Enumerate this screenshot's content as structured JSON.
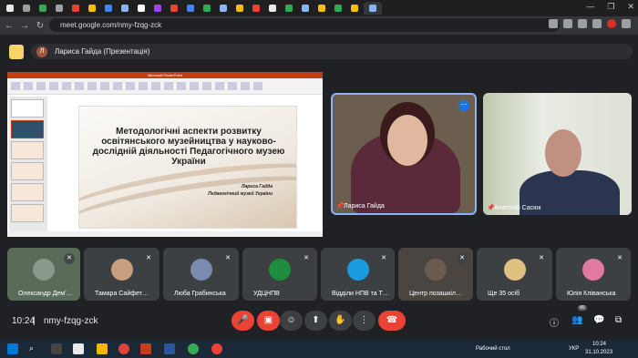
{
  "browser": {
    "url": "meet.google.com/nmy-fzqg-zck",
    "tab_colors": [
      "#e8eaed",
      "#9aa0a6",
      "#34a853",
      "#9aa0a6",
      "#ea4335",
      "#fbbc04",
      "#4285f4",
      "#8ab4f8",
      "#fff",
      "#a142f4",
      "#ea4335",
      "#4285f4",
      "#34a853",
      "#8ab4f8",
      "#fbbc04",
      "#ea4335",
      "#e8eaed",
      "#34a853",
      "#8ab4f8",
      "#fbbc04",
      "#34a853",
      "#fbbc04",
      "#8ab4f8"
    ],
    "window_controls": [
      "—",
      "❐",
      "✕"
    ]
  },
  "presenter": {
    "avatar_letter": "Л",
    "name": "Лариса Гайда (Презентація)"
  },
  "slide": {
    "app_title": "Microsoft PowerPoint",
    "title": "Методологічні аспекти розвитку освітянського музейництва у науково-дослідній діяльності Педагогічного музею України",
    "author": "Лариса Гайда",
    "org": "Педагогічний музей України"
  },
  "participants_main": [
    {
      "name": "Лариса Гайда"
    },
    {
      "name": "Анатолій Сасюк"
    }
  ],
  "participants_strip": [
    {
      "name": "Олександр Дем'…",
      "color": "#5a6b5a"
    },
    {
      "name": "Тамара Сайфет…",
      "color": "#3c4043"
    },
    {
      "name": "Люба Грабинська",
      "color": "#3c4043"
    },
    {
      "name": "УДЦНПВ",
      "color": "#3c4043"
    },
    {
      "name": "Відділи НПВ та Т…",
      "color": "#3c4043"
    },
    {
      "name": "Центр позашкіл…",
      "color": "#4a4540"
    },
    {
      "name": "Ще 35 осіб",
      "color": "#3c4043"
    },
    {
      "name": "Юлія Кліванська",
      "color": "#3c4043"
    }
  ],
  "meeting": {
    "time": "10:24",
    "code": "nmy-fzqg-zck",
    "people_count": "45"
  },
  "taskbar": {
    "desktop_label": "Рабочий стол",
    "lang": "УКР",
    "clock_time": "10:24",
    "clock_date": "31.10.2023"
  }
}
